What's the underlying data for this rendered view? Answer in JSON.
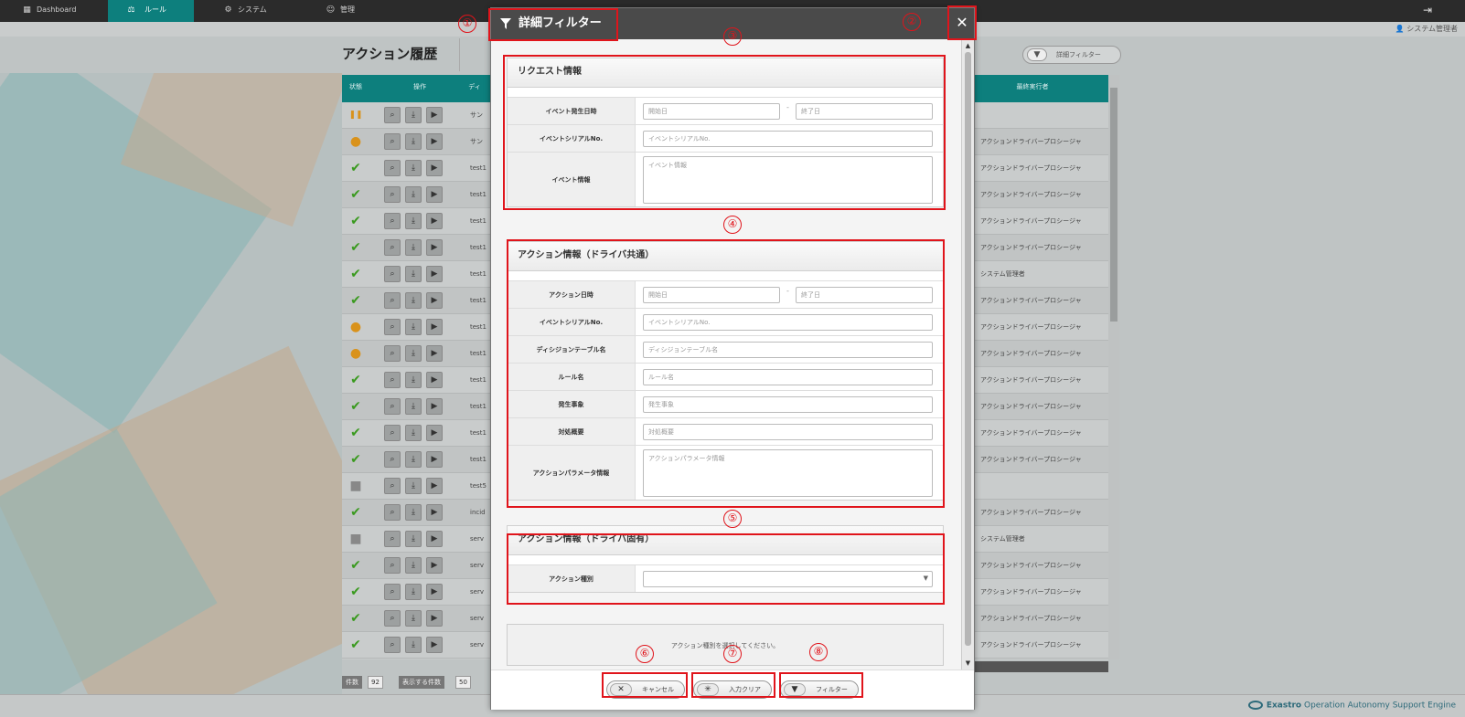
{
  "nav": {
    "items": [
      {
        "label": "Dashboard",
        "icon": "dashboard-icon",
        "active": false
      },
      {
        "label": "ルール",
        "icon": "scale-icon",
        "active": true
      },
      {
        "label": "システム",
        "icon": "network-icon",
        "active": false
      },
      {
        "label": "管理",
        "icon": "user-gear-icon",
        "active": false
      }
    ],
    "logout_icon": "logout-icon"
  },
  "user": {
    "label": "システム管理者"
  },
  "page": {
    "title": "アクション履歴",
    "filter_button": "詳細フィルター"
  },
  "table": {
    "headers": [
      "状態",
      "操作",
      "ディ",
      "最終実行者"
    ],
    "rows": [
      {
        "status": "pause",
        "name": "サン",
        "exec": ""
      },
      {
        "status": "warn",
        "name": "サン",
        "exec": "アクションドライバープロシージャ"
      },
      {
        "status": "ok",
        "name": "test1",
        "exec": "アクションドライバープロシージャ"
      },
      {
        "status": "ok",
        "name": "test1",
        "exec": "アクションドライバープロシージャ"
      },
      {
        "status": "ok",
        "name": "test1",
        "exec": "アクションドライバープロシージャ"
      },
      {
        "status": "ok",
        "name": "test1",
        "exec": "アクションドライバープロシージャ"
      },
      {
        "status": "ok",
        "name": "test1",
        "exec": "システム管理者"
      },
      {
        "status": "ok",
        "name": "test1",
        "exec": "アクションドライバープロシージャ"
      },
      {
        "status": "warn",
        "name": "test1",
        "exec": "アクションドライバープロシージャ"
      },
      {
        "status": "warn",
        "name": "test1",
        "exec": "アクションドライバープロシージャ"
      },
      {
        "status": "ok",
        "name": "test1",
        "exec": "アクションドライバープロシージャ"
      },
      {
        "status": "ok",
        "name": "test1",
        "exec": "アクションドライバープロシージャ"
      },
      {
        "status": "ok",
        "name": "test1",
        "exec": "アクションドライバープロシージャ"
      },
      {
        "status": "ok",
        "name": "test1",
        "exec": "アクションドライバープロシージャ"
      },
      {
        "status": "none",
        "name": "test5",
        "exec": ""
      },
      {
        "status": "ok",
        "name": "incid",
        "exec": "アクションドライバープロシージャ"
      },
      {
        "status": "none",
        "name": "serv",
        "exec": "システム管理者"
      },
      {
        "status": "ok",
        "name": "serv",
        "exec": "アクションドライバープロシージャ"
      },
      {
        "status": "ok",
        "name": "serv",
        "exec": "アクションドライバープロシージャ"
      },
      {
        "status": "ok",
        "name": "serv",
        "exec": "アクションドライバープロシージャ"
      },
      {
        "status": "ok",
        "name": "serv",
        "exec": "アクションドライバープロシージャ"
      }
    ],
    "footer": {
      "count_label": "件数",
      "count_value": "92",
      "display_label": "表示する件数",
      "display_value": "50"
    }
  },
  "modal": {
    "title": "詳細フィルター",
    "close_icon": "close-icon",
    "sections": {
      "request": {
        "title": "リクエスト情報",
        "event_datetime_label": "イベント発生日時",
        "start_placeholder": "開始日",
        "end_placeholder": "終了日",
        "serial_label": "イベントシリアルNo.",
        "serial_placeholder": "イベントシリアルNo.",
        "event_info_label": "イベント情報",
        "event_info_placeholder": "イベント情報"
      },
      "action_common": {
        "title": "アクション情報（ドライバ共通）",
        "action_datetime_label": "アクション日時",
        "start_placeholder": "開始日",
        "end_placeholder": "終了日",
        "serial_label": "イベントシリアルNo.",
        "serial_placeholder": "イベントシリアルNo.",
        "decision_table_label": "ディシジョンテーブル名",
        "decision_table_placeholder": "ディシジョンテーブル名",
        "rule_label": "ルール名",
        "rule_placeholder": "ルール名",
        "event_label": "発生事象",
        "event_placeholder": "発生事象",
        "response_label": "対処概要",
        "response_placeholder": "対処概要",
        "param_label": "アクションパラメータ情報",
        "param_placeholder": "アクションパラメータ情報"
      },
      "action_specific": {
        "title": "アクション情報（ドライバ固有）",
        "type_label": "アクション種別",
        "type_value": ""
      }
    },
    "notice": "アクション種別を選択してください。",
    "buttons": {
      "cancel": "キャンセル",
      "clear": "入力クリア",
      "filter": "フィルター"
    }
  },
  "annotations": [
    "①",
    "②",
    "③",
    "④",
    "⑤",
    "⑥",
    "⑦",
    "⑧"
  ],
  "brand": {
    "name": "Exastro",
    "tagline": "Operation Autonomy Support Engine"
  },
  "colors": {
    "accent": "#0d7f7d",
    "highlight": "#e0141b",
    "nav_bg": "#2b2b2b",
    "modal_head": "#4a4a4a"
  }
}
